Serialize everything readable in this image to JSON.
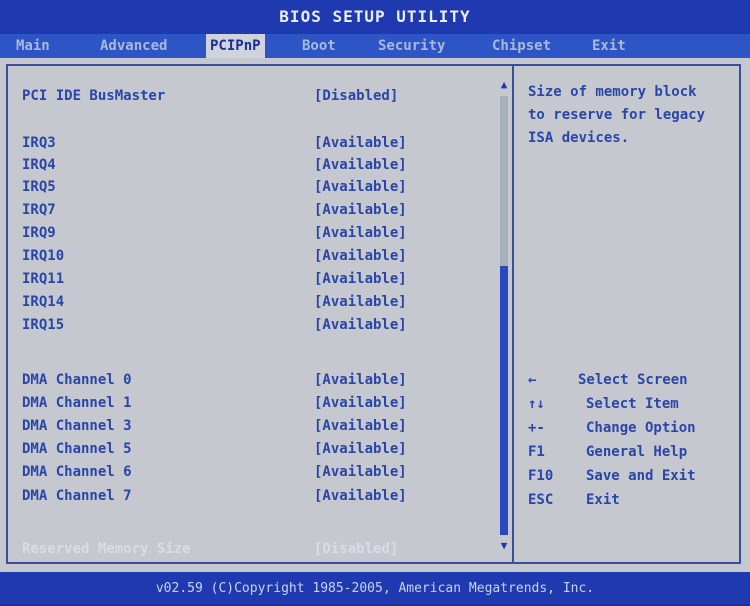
{
  "title": "BIOS SETUP UTILITY",
  "menu": [
    {
      "label": "Main"
    },
    {
      "label": "Advanced"
    },
    {
      "label": "PCIPnP"
    },
    {
      "label": "Boot"
    },
    {
      "label": "Security"
    },
    {
      "label": "Chipset"
    },
    {
      "label": "Exit"
    }
  ],
  "settings": [
    {
      "label": "PCI IDE BusMaster",
      "value": "[Disabled]"
    },
    {
      "label": "IRQ3",
      "value": "[Available]"
    },
    {
      "label": "IRQ4",
      "value": "[Available]"
    },
    {
      "label": "IRQ5",
      "value": "[Available]"
    },
    {
      "label": "IRQ7",
      "value": "[Available]"
    },
    {
      "label": "IRQ9",
      "value": "[Available]"
    },
    {
      "label": "IRQ10",
      "value": "[Available]"
    },
    {
      "label": "IRQ11",
      "value": "[Available]"
    },
    {
      "label": "IRQ14",
      "value": "[Available]"
    },
    {
      "label": "IRQ15",
      "value": "[Available]"
    },
    {
      "label": "DMA Channel 0",
      "value": "[Available]"
    },
    {
      "label": "DMA Channel 1",
      "value": "[Available]"
    },
    {
      "label": "DMA Channel 3",
      "value": "[Available]"
    },
    {
      "label": "DMA Channel 5",
      "value": "[Available]"
    },
    {
      "label": "DMA Channel 6",
      "value": "[Available]"
    },
    {
      "label": "DMA Channel 7",
      "value": "[Available]"
    },
    {
      "label": "Reserved Memory Size",
      "value": "[Disabled]"
    }
  ],
  "help": {
    "line1": "Size of memory block",
    "line2": "to reserve for legacy",
    "line3": "ISA devices."
  },
  "keys": [
    {
      "key": "←",
      "desc": "Select Screen"
    },
    {
      "key": "↑↓",
      "desc": "Select Item"
    },
    {
      "key": "+-",
      "desc": "Change Option"
    },
    {
      "key": "F1",
      "desc": "General Help"
    },
    {
      "key": "F10",
      "desc": "Save and Exit"
    },
    {
      "key": "ESC",
      "desc": "Exit"
    }
  ],
  "footer": "v02.59 (C)Copyright 1985-2005, American Megatrends, Inc.",
  "colors": {
    "background": "#1c2f92",
    "panel": "#c5c9cf",
    "text": "#2a45a8",
    "highlight": "#d8dce4"
  }
}
